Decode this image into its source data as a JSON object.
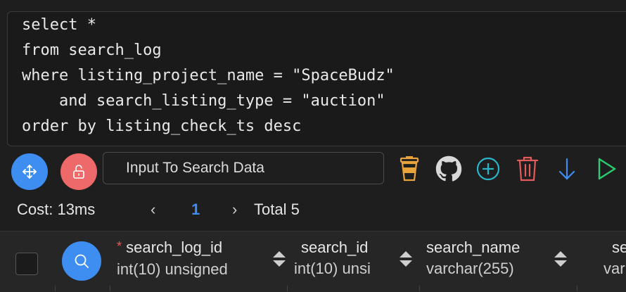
{
  "editor": {
    "lines": [
      "select *",
      "from search_log",
      "where listing_project_name = \"SpaceBudz\"",
      "    and search_listing_type = \"auction\"",
      "order by listing_check_ts desc"
    ]
  },
  "toolbar": {
    "search_placeholder": "Input To Search Data",
    "icons": [
      "move-icon",
      "unlock-icon",
      "coffee-icon",
      "github-icon",
      "add-icon",
      "trash-icon",
      "download-icon",
      "run-icon"
    ],
    "colors": {
      "blue": "#3d8ef0",
      "red": "#ee6a6a",
      "orange": "#e8a33a",
      "teal": "#2bb3c9",
      "pink": "#e25a5a",
      "green": "#2ecc71"
    }
  },
  "pager": {
    "cost_label": "Cost: 13ms",
    "prev": "‹",
    "current_page": "1",
    "next": "›",
    "total_label": "Total 5"
  },
  "table": {
    "columns": [
      {
        "name": "search_log_id",
        "type": "int(10) unsigned",
        "required": true
      },
      {
        "name": "search_id",
        "type": "int(10) unsi",
        "required": false
      },
      {
        "name": "search_name",
        "type": "varchar(255)",
        "required": false
      },
      {
        "name": "se",
        "type": "var",
        "required": false
      }
    ],
    "required_marker": "*"
  }
}
